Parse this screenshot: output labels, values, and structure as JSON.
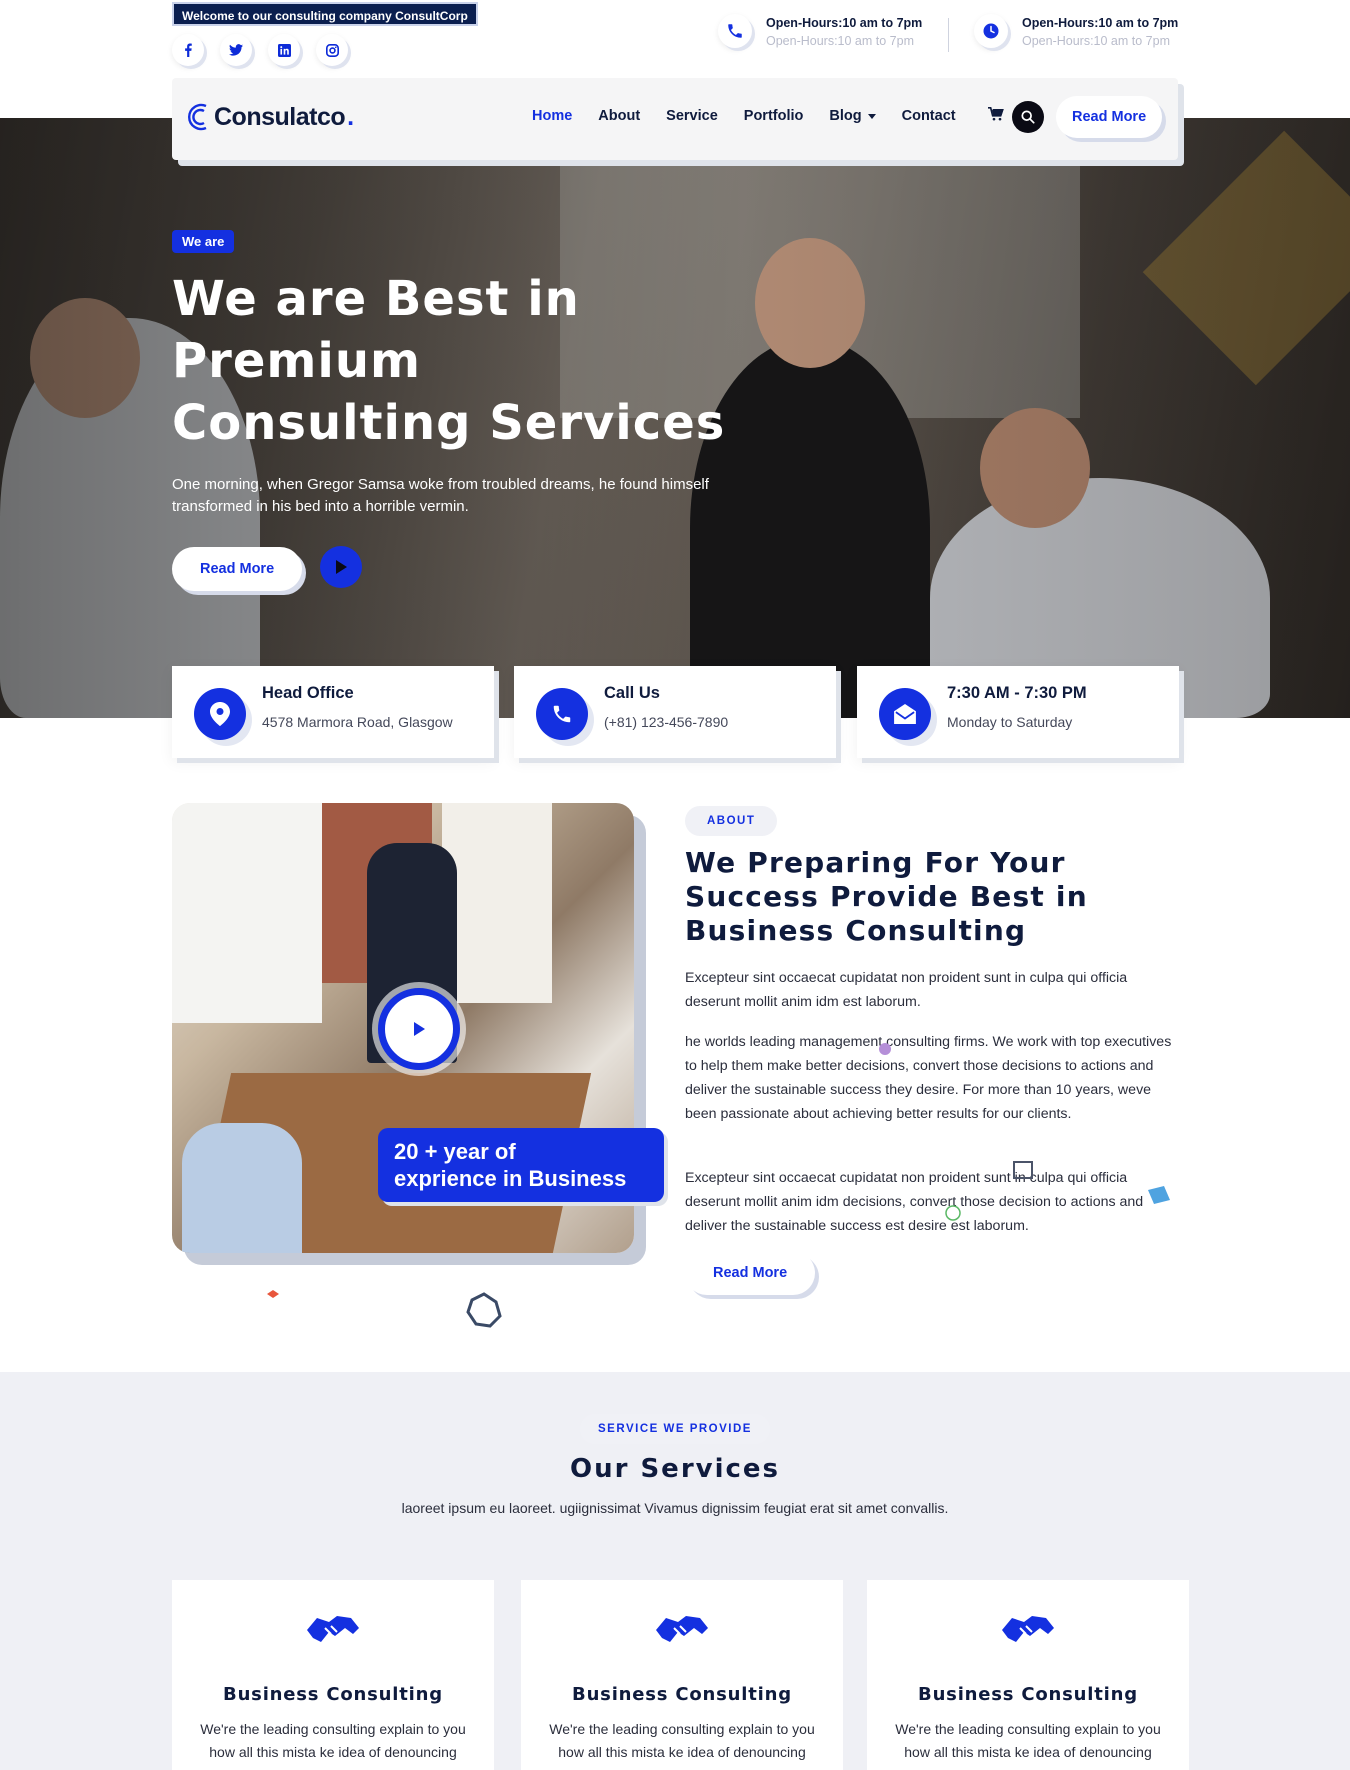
{
  "topbar": {
    "welcome": "Welcome to our consulting company ConsultCorp",
    "socials": [
      "f",
      "t",
      "in",
      "ig"
    ],
    "hours": [
      {
        "title": "Open-Hours:10 am to 7pm",
        "sub": "Open-Hours:10 am to 7pm",
        "icon": "phone-icon"
      },
      {
        "title": "Open-Hours:10 am to 7pm",
        "sub": "Open-Hours:10 am to 7pm",
        "icon": "clock-icon"
      }
    ]
  },
  "nav": {
    "logo": "Consulatco",
    "logo_dot": ".",
    "items": [
      "Home",
      "About",
      "Service",
      "Portfolio",
      "Blog",
      "Contact"
    ],
    "active": "Home",
    "read_more": "Read More"
  },
  "hero": {
    "badge": "We are",
    "title": "We are Best in Premium Consulting Services",
    "text": "One morning, when Gregor Samsa woke from troubled dreams, he found himself transformed in his bed into a horrible vermin.",
    "button": "Read More"
  },
  "info_cards": [
    {
      "title": "Head Office",
      "sub": "4578 Marmora Road, Glasgow",
      "icon": "location-pin-icon"
    },
    {
      "title": "Call Us",
      "sub": "(+81) 123-456-7890",
      "icon": "phone-icon"
    },
    {
      "title": "7:30 AM - 7:30 PM",
      "sub": "Monday to Saturday",
      "icon": "envelope-icon"
    }
  ],
  "about": {
    "tag": "ABOUT",
    "title": "We Preparing For Your Success Provide Best in Business Consulting",
    "p1": "Excepteur sint occaecat cupidatat non proident sunt in culpa qui officia deserunt mollit anim idm est laborum.",
    "p2": "he worlds leading management consulting firms. We work with top executives to help them make better decisions, convert those decisions to actions and deliver the sustainable success they desire. For more than 10 years, weve been passionate about achieving better results for our clients.",
    "p3": "Excepteur sint occaecat cupidatat non proident sunt in culpa qui officia deserunt mollit anim idm decisions, convert those decision to actions and deliver the sustainable success est desire est laborum.",
    "button": "Read More",
    "experience_line1": "20 + year of",
    "experience_line2": "exprience in Business"
  },
  "services": {
    "tag": "SERVICE WE PROVIDE",
    "title": "Our Services",
    "subtitle": "laoreet ipsum eu laoreet. ugiignissimat Vivamus dignissim feugiat erat sit amet convallis.",
    "cards": [
      {
        "title": "Business Consulting",
        "text": "We're the leading consulting explain to you how all this mista ke idea of denouncing pleasure and praising pain"
      },
      {
        "title": "Business Consulting",
        "text": "We're the leading consulting explain to you how all this mista ke idea of denouncing pleasure and praising pain"
      },
      {
        "title": "Business Consulting",
        "text": "We're the leading consulting explain to you how all this mista ke idea of denouncing pleasure and praising pain"
      }
    ]
  },
  "colors": {
    "accent": "#1430e0",
    "dark": "#0f1b3d",
    "section_bg": "#eff0f5"
  }
}
